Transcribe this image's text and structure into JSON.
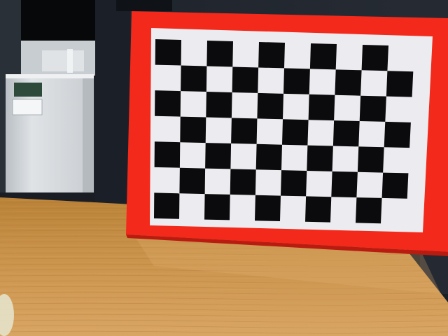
{
  "scene": {
    "subject": "checkerboard-calibration-target",
    "board": {
      "rows": 7,
      "cols": 10,
      "dark_color": "#0b0b0d",
      "light_color": "#ececf0",
      "frame_color": "#f3291b"
    },
    "colors": {
      "wall": "#1f242c",
      "wall_shadow": "#141820",
      "window_black": "#07080a",
      "fridge": "#d9dde0",
      "table": "#c58e45",
      "table_light": "#d8a55f",
      "table_dark": "#b27a34"
    }
  }
}
